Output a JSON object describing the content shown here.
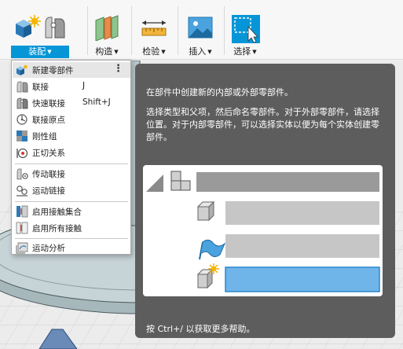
{
  "toolbar": {
    "groups": [
      {
        "id": "assemble",
        "label": "装配",
        "icon": "assemble-icon",
        "active": true
      },
      {
        "id": "construct",
        "label": "构造",
        "icon": "construct-icon",
        "active": false
      },
      {
        "id": "inspect",
        "label": "检验",
        "icon": "measure-icon",
        "active": false
      },
      {
        "id": "insert",
        "label": "插入",
        "icon": "insert-image-icon",
        "active": false
      },
      {
        "id": "select",
        "label": "选择",
        "icon": "select-icon",
        "active": false
      }
    ],
    "caret": "▼"
  },
  "menu": {
    "items": [
      {
        "label": "新建零部件",
        "shortcut": "",
        "icon": "new-component-icon"
      },
      {
        "label": "联接",
        "shortcut": "J",
        "icon": "joint-icon"
      },
      {
        "label": "快速联接",
        "shortcut": "Shift+J",
        "icon": "as-built-joint-icon"
      },
      {
        "label": "联接原点",
        "shortcut": "",
        "icon": "joint-origin-icon"
      },
      {
        "label": "刚性组",
        "shortcut": "",
        "icon": "rigid-group-icon"
      },
      {
        "label": "正切关系",
        "shortcut": "",
        "icon": "tangent-relationship-icon"
      },
      {
        "label": "传动联接",
        "shortcut": "",
        "icon": "drive-joints-icon"
      },
      {
        "label": "运动链接",
        "shortcut": "",
        "icon": "motion-link-icon"
      },
      {
        "label": "启用接触集合",
        "shortcut": "",
        "icon": "enable-contact-sets-icon"
      },
      {
        "label": "启用所有接触",
        "shortcut": "",
        "icon": "enable-all-contact-icon"
      },
      {
        "label": "运动分析",
        "shortcut": "",
        "icon": "motion-study-icon"
      }
    ],
    "more_glyph": "⋮"
  },
  "tooltip": {
    "title": "在部件中创建新的内部或外部零部件。",
    "description": "选择类型和父项，然后命名零部件。对于外部零部件，请选择位置。对于内部零部件，可以选择实体以便为每个实体创建零部件。",
    "help": "按 Ctrl+/ 以获取更多帮助。"
  },
  "colors": {
    "accent": "#0696d7",
    "tooltip_bg": "#5d5d5d",
    "highlight_field": "#6fb5ea"
  }
}
